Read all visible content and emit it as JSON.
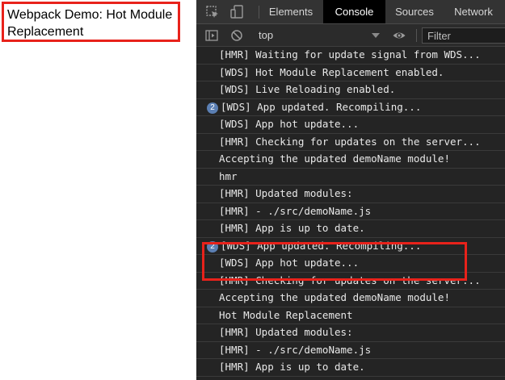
{
  "app": {
    "title": "Webpack Demo: Hot Module Replacement"
  },
  "devtools": {
    "tabs": [
      {
        "label": "Elements",
        "active": false
      },
      {
        "label": "Console",
        "active": true
      },
      {
        "label": "Sources",
        "active": false
      },
      {
        "label": "Network",
        "active": false
      }
    ],
    "toolbar": {
      "context": "top",
      "filter_placeholder": "Filter"
    },
    "console": [
      {
        "count": "",
        "text": "[HMR] Waiting for update signal from WDS..."
      },
      {
        "count": "",
        "text": "[WDS] Hot Module Replacement enabled."
      },
      {
        "count": "",
        "text": "[WDS] Live Reloading enabled."
      },
      {
        "count": "2",
        "text": "[WDS] App updated. Recompiling..."
      },
      {
        "count": "",
        "text": "[WDS] App hot update..."
      },
      {
        "count": "",
        "text": "[HMR] Checking for updates on the server..."
      },
      {
        "count": "",
        "text": "Accepting the updated demoName module!"
      },
      {
        "count": "",
        "text": "hmr"
      },
      {
        "count": "",
        "text": "[HMR] Updated modules:"
      },
      {
        "count": "",
        "text": "[HMR]  - ./src/demoName.js"
      },
      {
        "count": "",
        "text": "[HMR] App is up to date."
      },
      {
        "count": "2",
        "text": "[WDS] App updated. Recompiling..."
      },
      {
        "count": "",
        "text": "[WDS] App hot update..."
      },
      {
        "count": "",
        "text": "[HMR] Checking for updates on the server..."
      },
      {
        "count": "",
        "text": "Accepting the updated demoName module!"
      },
      {
        "count": "",
        "text": "Hot Module Replacement"
      },
      {
        "count": "",
        "text": "[HMR] Updated modules:"
      },
      {
        "count": "",
        "text": "[HMR]  - ./src/demoName.js"
      },
      {
        "count": "",
        "text": "[HMR] App is up to date."
      }
    ]
  },
  "colors": {
    "highlight": "#e8221b",
    "devtools_bg": "#242424",
    "badge": "#5b7fb3"
  },
  "icons": {
    "inspect": "cursor-select-icon",
    "device": "device-toggle-icon",
    "sidebar": "sidebar-toggle-icon",
    "clear": "clear-console-icon",
    "eye": "live-expression-eye-icon"
  }
}
